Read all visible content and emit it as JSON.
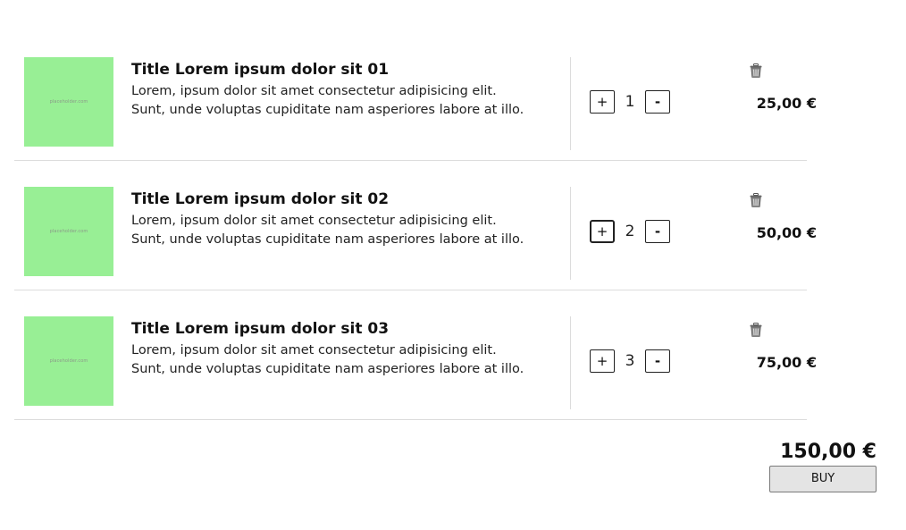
{
  "cart": {
    "items": [
      {
        "image_placeholder": "placeholder.com",
        "title": "Title Lorem ipsum dolor sit 01",
        "description": "Lorem, ipsum dolor sit amet consectetur adipisicing elit. Sunt, unde voluptas cupiditate nam asperiores labore at illo.",
        "plus_label": "+",
        "quantity": "1",
        "minus_label": "-",
        "price": "25,00 €",
        "delete_icon": "trash-icon"
      },
      {
        "image_placeholder": "placeholder.com",
        "title": "Title Lorem ipsum dolor sit 02",
        "description": "Lorem, ipsum dolor sit amet consectetur adipisicing elit. Sunt, unde voluptas cupiditate nam asperiores labore at illo.",
        "plus_label": "+",
        "quantity": "2",
        "minus_label": "-",
        "price": "50,00 €",
        "delete_icon": "trash-icon"
      },
      {
        "image_placeholder": "placeholder.com",
        "title": "Title Lorem ipsum dolor sit 03",
        "description": "Lorem, ipsum dolor sit amet consectetur adipisicing elit. Sunt, unde voluptas cupiditate nam asperiores labore at illo.",
        "plus_label": "+",
        "quantity": "3",
        "minus_label": "-",
        "price": "75,00 €",
        "delete_icon": "trash-icon"
      }
    ],
    "total": "150,00 €",
    "buy_label": "BUY"
  },
  "colors": {
    "thumbnail_bg": "#98ef95",
    "divider": "#dcdcdc",
    "buy_button_bg": "#e4e4e4"
  }
}
